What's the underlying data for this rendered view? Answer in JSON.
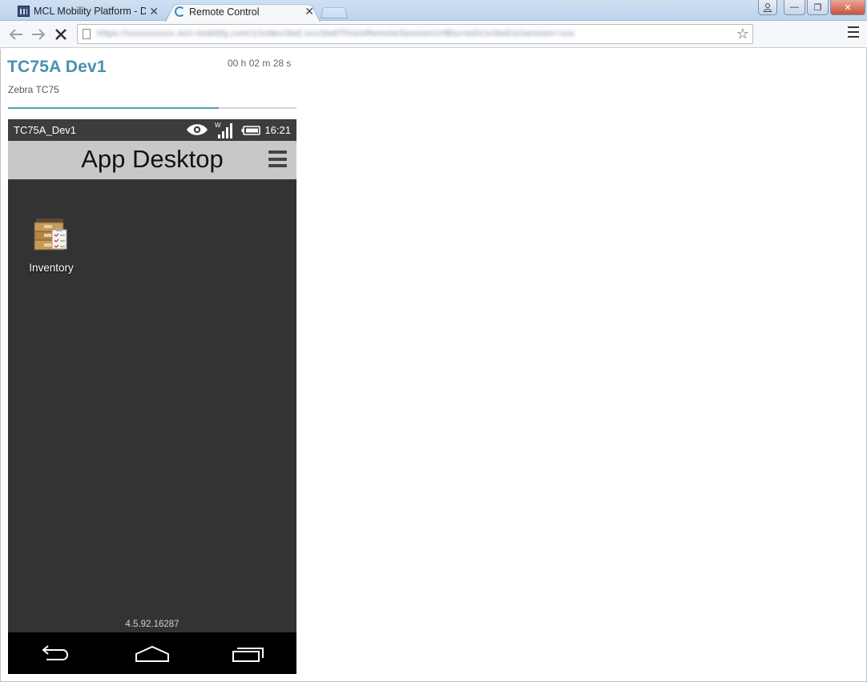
{
  "browser": {
    "tabs": [
      {
        "title": "MCL Mobility Platform - D",
        "icon": "mcl-app-icon",
        "active": false
      },
      {
        "title": "Remote Control",
        "icon": "loading-spinner-icon",
        "active": true
      }
    ],
    "close_glyph": "✕",
    "url": "https://xxxxxxxxxx.mcl-mobility.com/1/index/dsd.xxx/dsd/ThisIsRemoteSessionUrlBlurredX/x/dsd/ui/session=xxx",
    "controls": {
      "minimize": "—",
      "maximize": "❐",
      "close": "✕"
    }
  },
  "device": {
    "name": "TC75A Dev1",
    "model": "Zebra TC75",
    "session_timer": "00 h 02 m 28 s",
    "progress": 0.73
  },
  "phone": {
    "status_bar": {
      "device_name": "TC75A_Dev1",
      "wifi_label": "W",
      "time": "16:21"
    },
    "app_bar": {
      "title": "App Desktop"
    },
    "apps": [
      {
        "label": "Inventory",
        "icon": "inventory-boxes-icon"
      }
    ],
    "version": "4.5.92.16287"
  },
  "colors": {
    "accent": "#4a90ad",
    "progress": "#4aa3a8",
    "phone_bg": "#333333",
    "app_bar": "#c8c8c8"
  }
}
